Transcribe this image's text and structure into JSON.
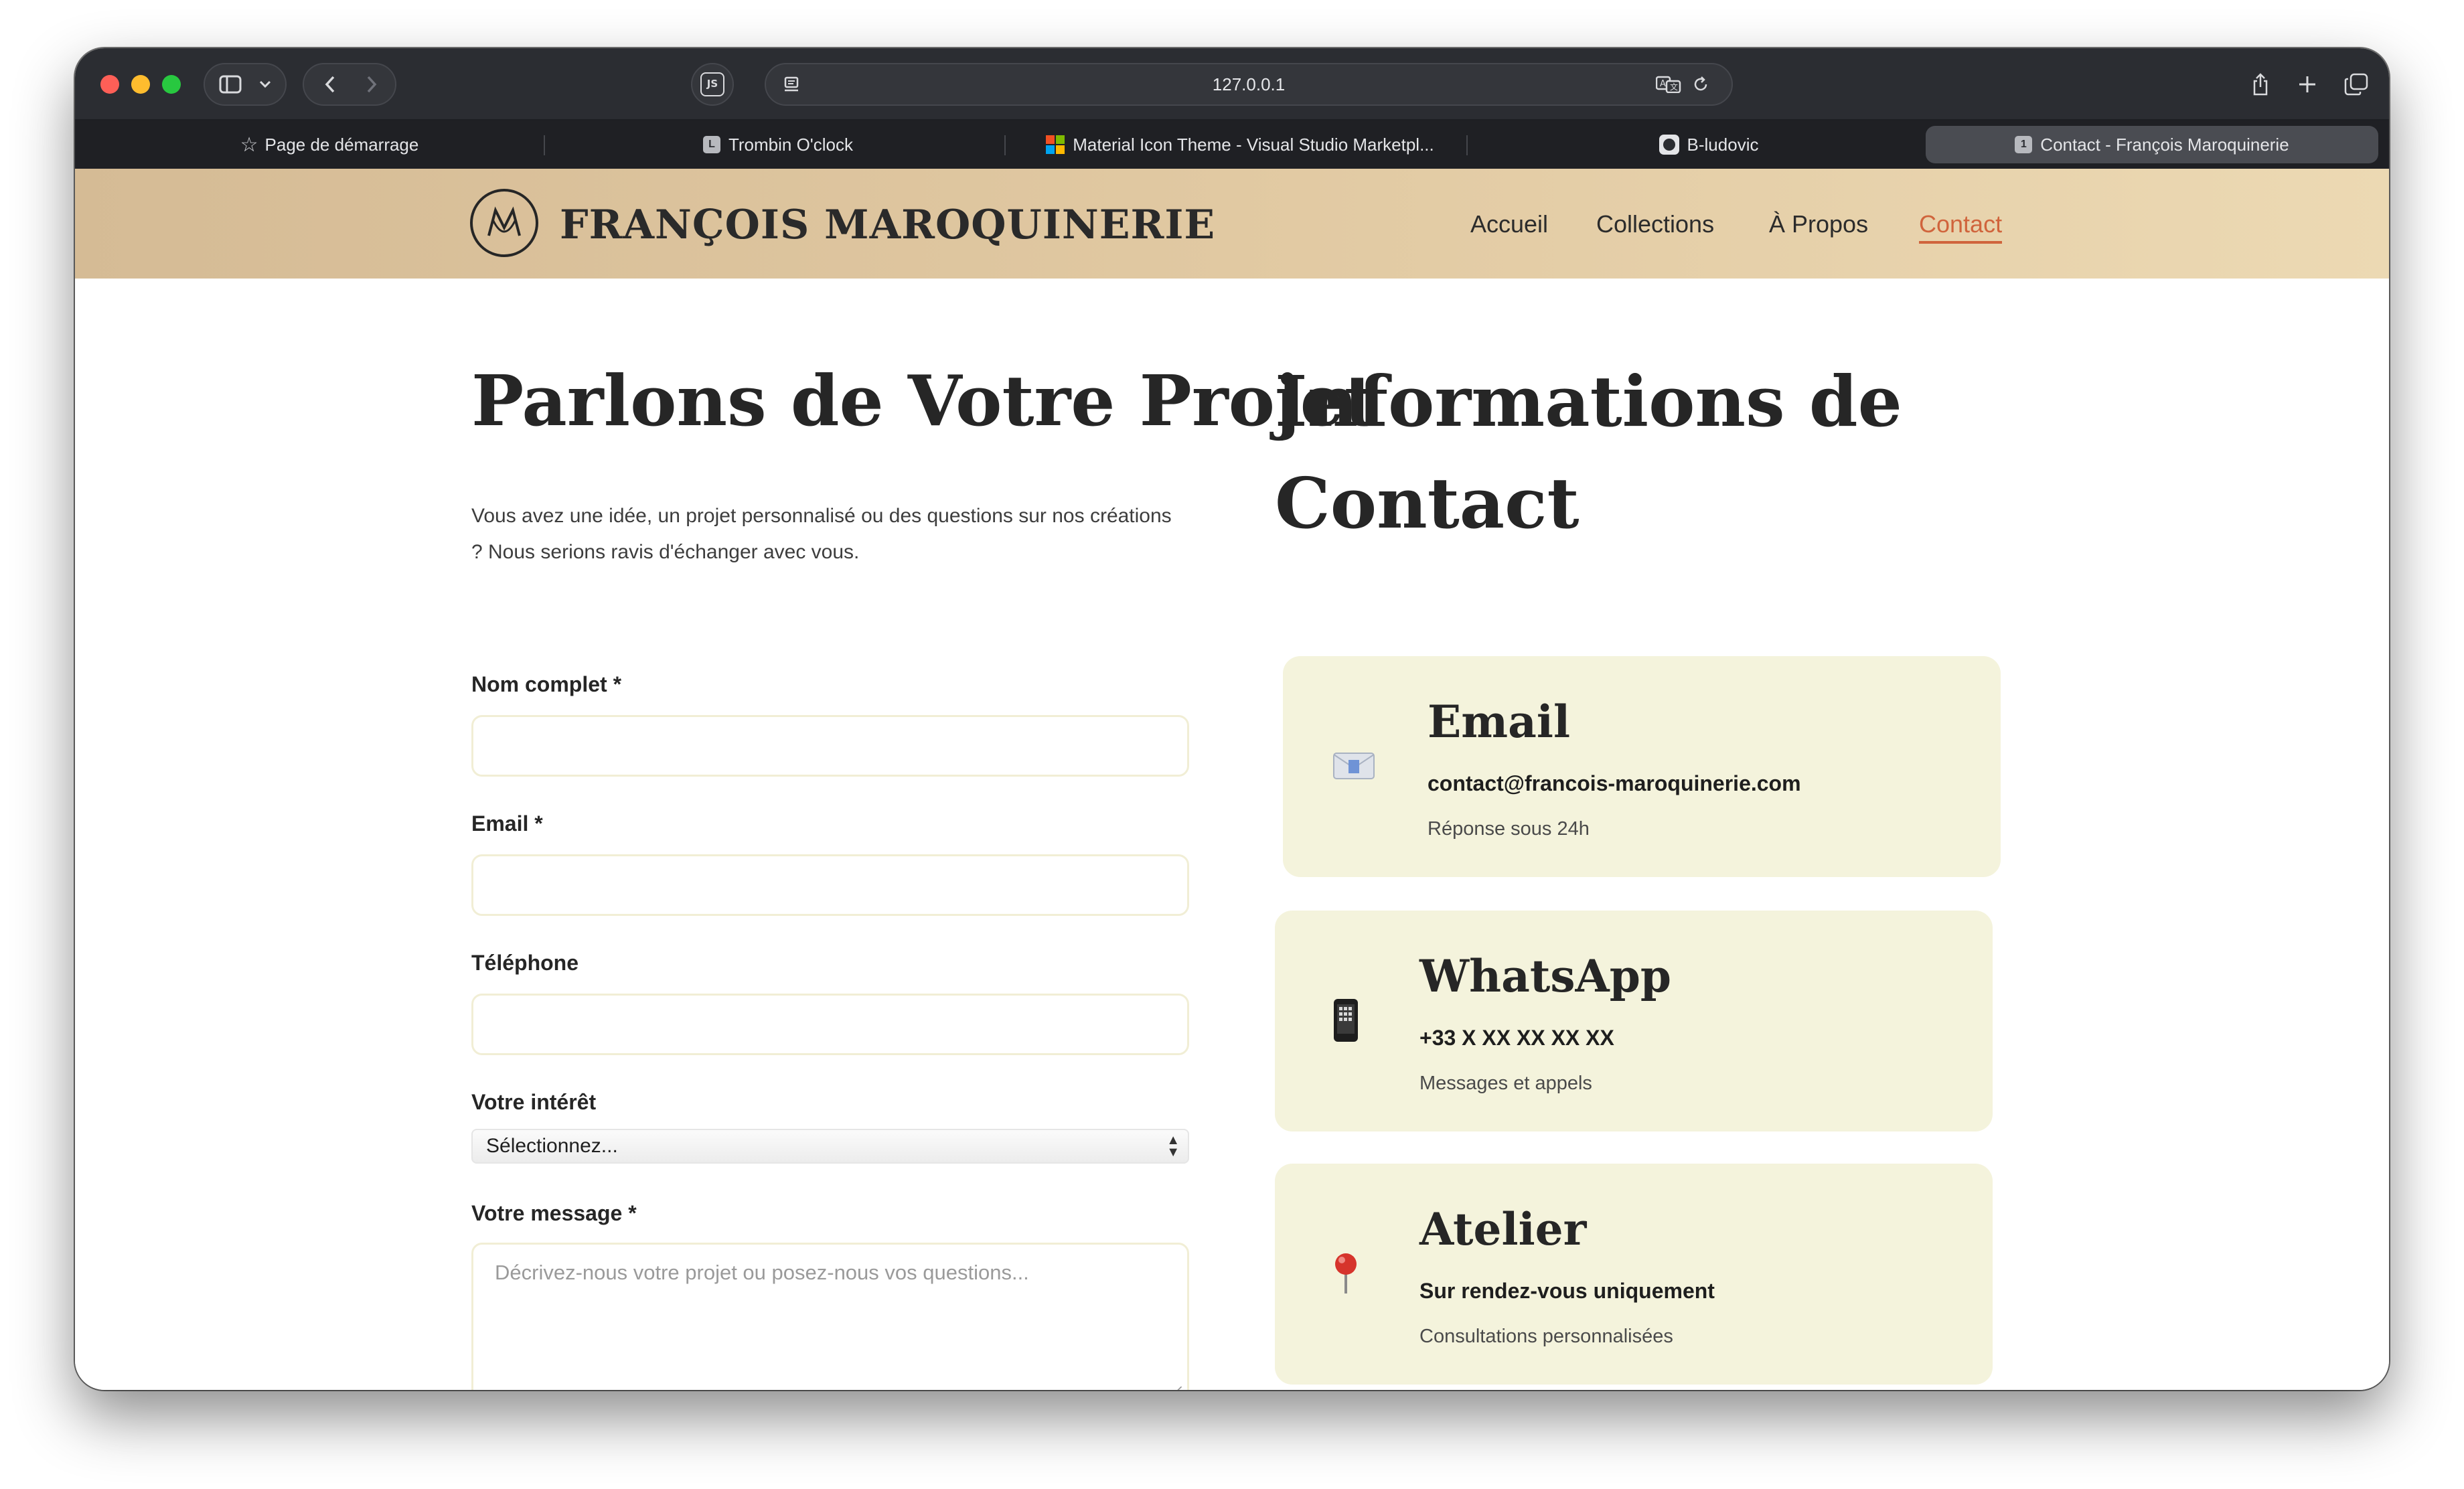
{
  "browser": {
    "url": "127.0.0.1",
    "tabs": [
      {
        "label": "Page de démarrage",
        "icon": "star-icon"
      },
      {
        "label": "Trombin O'clock",
        "icon": "L"
      },
      {
        "label": "Material Icon Theme - Visual Studio Marketpl...",
        "icon": "microsoft-icon"
      },
      {
        "label": "B-ludovic",
        "icon": "github-icon"
      },
      {
        "label": "Contact - François Maroquinerie",
        "icon": "1"
      }
    ],
    "extension_label": "JS"
  },
  "site": {
    "brand": "FRANÇOIS MAROQUINERIE",
    "nav": [
      "Accueil",
      "Collections",
      "À Propos",
      "Contact"
    ],
    "active_nav": "Contact",
    "accent_color": "#d0643c"
  },
  "form": {
    "title": "Parlons de Votre Projet",
    "intro_line1": "Vous avez une idée, un projet personnalisé ou des questions sur nos créations",
    "intro_line2": "? Nous serions ravis d'échanger avec vous.",
    "name_label": "Nom complet *",
    "email_label": "Email *",
    "phone_label": "Téléphone",
    "interest_label": "Votre intérêt",
    "interest_value": "Sélectionnez...",
    "message_label": "Votre message *",
    "message_placeholder": "Décrivez-nous votre projet ou posez-nous vos questions..."
  },
  "contact": {
    "title_line1": "Informations de",
    "title_line2": "Contact",
    "cards": [
      {
        "title": "Email",
        "main": "contact@francois-maroquinerie.com",
        "sub": "Réponse sous 24h",
        "icon": "envelope-icon"
      },
      {
        "title": "WhatsApp",
        "main": "+33 X XX XX XX XX",
        "sub": "Messages et appels",
        "icon": "mobile-phone-icon"
      },
      {
        "title": "Atelier",
        "main": "Sur rendez-vous uniquement",
        "sub": "Consultations personnalisées",
        "icon": "pin-icon"
      }
    ]
  }
}
